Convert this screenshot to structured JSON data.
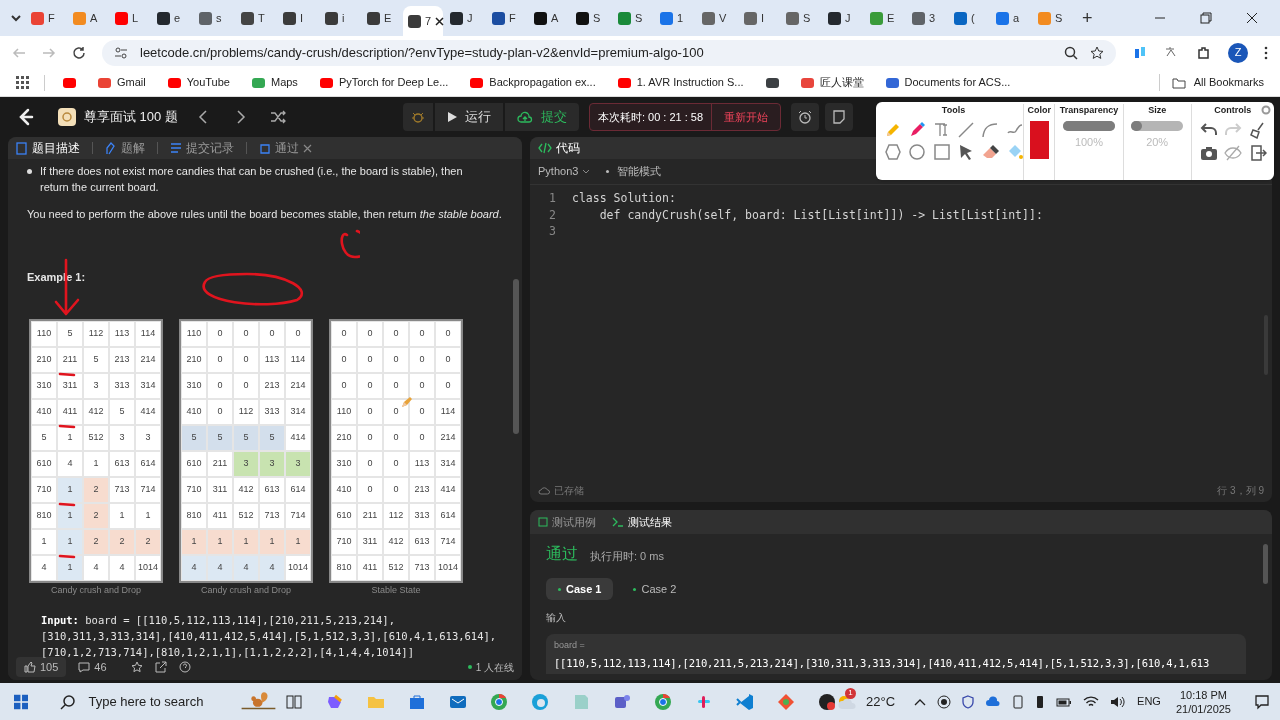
{
  "browser": {
    "tabs": [
      {
        "label": "F",
        "color": "#ea4335",
        "selected": false
      },
      {
        "label": "A",
        "color": "#f28b20",
        "selected": false
      },
      {
        "label": "L",
        "color": "#ff0000",
        "selected": false
      },
      {
        "label": "e",
        "color": "#24292f",
        "selected": false
      },
      {
        "label": "s",
        "color": "#5f6368",
        "selected": false
      },
      {
        "label": "T",
        "color": "#444444",
        "selected": false
      },
      {
        "label": "I",
        "color": "#3b3b3b",
        "selected": false
      },
      {
        "label": "i",
        "color": "#3b3b3b",
        "selected": false
      },
      {
        "label": "E",
        "color": "#3b3b3b",
        "selected": false
      },
      {
        "label": "7",
        "color": "#3b3b3b",
        "selected": true
      },
      {
        "label": "J",
        "color": "#24292f",
        "selected": false
      },
      {
        "label": "F",
        "color": "#1b4da1",
        "selected": false
      },
      {
        "label": "A",
        "color": "#111111",
        "selected": false
      },
      {
        "label": "S",
        "color": "#111111",
        "selected": false
      },
      {
        "label": "S",
        "color": "#1a8a3a",
        "selected": false
      },
      {
        "label": "1",
        "color": "#1a73e8",
        "selected": false
      },
      {
        "label": "V",
        "color": "#666666",
        "selected": false
      },
      {
        "label": "I",
        "color": "#666666",
        "selected": false
      },
      {
        "label": "S",
        "color": "#666666",
        "selected": false
      },
      {
        "label": "J",
        "color": "#24292f",
        "selected": false
      },
      {
        "label": "E",
        "color": "#3a9b3a",
        "selected": false
      },
      {
        "label": "3",
        "color": "#5f6368",
        "selected": false
      },
      {
        "label": "(",
        "color": "#0a66c2",
        "selected": false
      },
      {
        "label": "a",
        "color": "#1a73e8",
        "selected": false
      },
      {
        "label": "S",
        "color": "#f28b20",
        "selected": false
      }
    ],
    "new_tab": "+",
    "url": "leetcode.cn/problems/candy-crush/description/?envType=study-plan-v2&envId=premium-algo-100",
    "profile": "Z",
    "bookmarks": [
      {
        "color": "#ff0000"
      },
      {
        "label": "Gmail",
        "color": "#ea4335"
      },
      {
        "label": "YouTube",
        "color": "#ff0000"
      },
      {
        "label": "Maps",
        "color": "#34a853"
      },
      {
        "label": "PyTorch for Deep Le...",
        "color": "#ff0000"
      },
      {
        "label": "Backpropagation ex...",
        "color": "#ff0000"
      },
      {
        "label": "1. AVR Instruction S...",
        "color": "#ff0000"
      },
      {
        "color": "#3c4043"
      },
      {
        "label": "匠人课堂",
        "color": "#e8453c"
      },
      {
        "label": "Documents for ACS...",
        "color": "#3367d6"
      }
    ],
    "all_bookmarks": "All Bookmarks"
  },
  "header": {
    "plan": "尊享面试 100 题",
    "run": "运行",
    "submit": "提交",
    "timer": "本次耗时: 00 : 21 : 58",
    "restart": "重新开始"
  },
  "left_panel": {
    "tabs": [
      {
        "label": "题目描述",
        "selected": true
      },
      {
        "label": "题解",
        "selected": false
      },
      {
        "label": "提交记录",
        "selected": false
      },
      {
        "label": "通过",
        "selected": false
      }
    ],
    "bullet": "If there does not exist more candies that can be crushed (i.e., the board is stable), then return the current board.",
    "paragraph": "You need to perform the above rules until the board becomes stable, then return *the stable board*.",
    "example_title": "Example 1:",
    "boards": [
      {
        "caption": "Candy crush and Drop",
        "rows": [
          [
            "110",
            "5",
            "112",
            "113",
            "114"
          ],
          [
            "210",
            "211",
            "5",
            "213",
            "214"
          ],
          [
            "310",
            "311",
            "3",
            "313",
            "314"
          ],
          [
            "410",
            "411",
            "412",
            "5",
            "414"
          ],
          [
            "5",
            "1",
            "512",
            "3",
            "3"
          ],
          [
            "610",
            "4",
            "1",
            "613",
            "614"
          ],
          [
            "710",
            {
              "text": "1",
              "color": "#dce8f3"
            },
            {
              "text": "2",
              "color": "#f7dccf"
            },
            "713",
            "714"
          ],
          [
            "810",
            {
              "text": "1",
              "color": "#dce8f3"
            },
            {
              "text": "2",
              "color": "#f7dccf"
            },
            "1",
            "1"
          ],
          [
            "1",
            {
              "text": "1",
              "color": "#dce8f3"
            },
            {
              "text": "2",
              "color": "#f7dccf"
            },
            {
              "text": "2",
              "color": "#f7dccf"
            },
            {
              "text": "2",
              "color": "#f7dccf"
            }
          ],
          [
            "4",
            {
              "text": "1",
              "color": "#dce8f3"
            },
            "4",
            "4",
            "1014"
          ]
        ]
      },
      {
        "caption": "Candy crush and Drop",
        "rows": [
          [
            "110",
            "0",
            "0",
            "0",
            "0"
          ],
          [
            "210",
            "0",
            "0",
            "113",
            "114"
          ],
          [
            "310",
            "0",
            "0",
            "213",
            "214"
          ],
          [
            "410",
            "0",
            "112",
            "313",
            "314"
          ],
          [
            {
              "text": "5",
              "color": "#d3dfec"
            },
            {
              "text": "5",
              "color": "#d3dfec"
            },
            {
              "text": "5",
              "color": "#d3dfec"
            },
            {
              "text": "5",
              "color": "#d3dfec"
            },
            "414"
          ],
          [
            "610",
            "211",
            {
              "text": "3",
              "color": "#c8e3b0"
            },
            {
              "text": "3",
              "color": "#c8e3b0"
            },
            {
              "text": "3",
              "color": "#c8e3b0"
            }
          ],
          [
            "710",
            "311",
            "412",
            "613",
            "614"
          ],
          [
            "810",
            "411",
            "512",
            "713",
            "714"
          ],
          [
            {
              "text": "1",
              "color": "#f7dccf"
            },
            {
              "text": "1",
              "color": "#f7dccf"
            },
            {
              "text": "1",
              "color": "#f7dccf"
            },
            {
              "text": "1",
              "color": "#f7dccf"
            },
            {
              "text": "1",
              "color": "#f7dccf"
            }
          ],
          [
            {
              "text": "4",
              "color": "#dce8f3"
            },
            {
              "text": "4",
              "color": "#dce8f3"
            },
            {
              "text": "4",
              "color": "#dce8f3"
            },
            {
              "text": "4",
              "color": "#dce8f3"
            },
            "1014"
          ]
        ]
      },
      {
        "caption": "Stable State",
        "rows": [
          [
            "0",
            "0",
            "0",
            "0",
            "0"
          ],
          [
            "0",
            "0",
            "0",
            "0",
            "0"
          ],
          [
            "0",
            "0",
            "0",
            "0",
            "0"
          ],
          [
            "110",
            "0",
            "0",
            "0",
            "114"
          ],
          [
            "210",
            "0",
            "0",
            "0",
            "214"
          ],
          [
            "310",
            "0",
            "0",
            "113",
            "314"
          ],
          [
            "410",
            "0",
            "0",
            "213",
            "414"
          ],
          [
            "610",
            "211",
            "112",
            "313",
            "614"
          ],
          [
            "710",
            "311",
            "412",
            "613",
            "714"
          ],
          [
            "810",
            "411",
            "512",
            "713",
            "1014"
          ]
        ]
      }
    ],
    "input_label": "Input:",
    "input_value": " board = [[110,5,112,113,114],[210,211,5,213,214],[310,311,3,313,314],[410,411,412,5,414],[5,1,512,3,3],[610,4,1,613,614],[710,1,2,713,714],[810,1,2,1,1],[1,1,2,2,2],[4,1,4,4,1014]]",
    "likes": "105",
    "comments": "46",
    "online": "1 人在线"
  },
  "code_panel": {
    "title": "代码",
    "language": "Python3",
    "mode": "智能模式",
    "lines": [
      {
        "number": "1",
        "code": "class Solution:"
      },
      {
        "number": "2",
        "code": "    def candyCrush(self, board: List[List[int]]) -> List[List[int]]:"
      },
      {
        "number": "3"
      }
    ],
    "saved": "已存储",
    "cursor": "行 3，列 9"
  },
  "test_panel": {
    "tabs": [
      {
        "label": "测试用例",
        "selected": false
      },
      {
        "label": "测试结果",
        "selected": true
      }
    ],
    "status": "通过",
    "runtime": "执行用时: 0 ms",
    "cases": [
      {
        "label": "Case 1",
        "selected": true
      },
      {
        "label": "Case 2",
        "selected": false
      }
    ],
    "input_heading": "输入",
    "param_name": "board =",
    "param_value": "[[110,5,112,113,114],[210,211,5,213,214],[310,311,3,313,314],[410,411,412,5,414],[5,1,512,3,3],[610,4,1,613"
  },
  "toolbox": {
    "sections": [
      "Tools",
      "Color",
      "Transparency",
      "Size",
      "Controls"
    ],
    "color": "#d9101e",
    "transparency": {
      "level": 1,
      "reading": "100%"
    },
    "size": {
      "level": 0.2,
      "reading": "20%"
    }
  },
  "taskbar": {
    "search_placeholder": "Type here to search",
    "weather_badge": "1",
    "temperature": "22°C",
    "language": "ENG",
    "time": "10:18 PM",
    "date": "21/01/2025"
  }
}
